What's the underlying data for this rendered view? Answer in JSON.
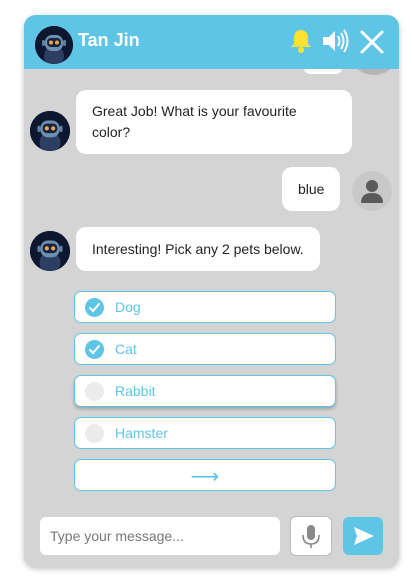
{
  "header": {
    "title": "Tan Jin",
    "accent": "#5ec5e6",
    "bell_icon": "bell-icon",
    "bell_color": "#ffe033",
    "speaker_icon": "speaker-icon",
    "close_icon": "close-icon"
  },
  "messages": [
    {
      "from": "bot",
      "text": "Great Job! What is your favourite color?"
    },
    {
      "from": "user",
      "text": "blue"
    },
    {
      "from": "bot",
      "text": "Interesting! Pick any 2 pets below."
    }
  ],
  "options": [
    {
      "label": "Dog",
      "checked": true
    },
    {
      "label": "Cat",
      "checked": true
    },
    {
      "label": "Rabbit",
      "checked": false
    },
    {
      "label": "Hamster",
      "checked": false
    }
  ],
  "submit": {
    "arrow": "⟶"
  },
  "composer": {
    "placeholder": "Type your message...",
    "mic_icon": "microphone-icon",
    "send_icon": "send-icon"
  }
}
